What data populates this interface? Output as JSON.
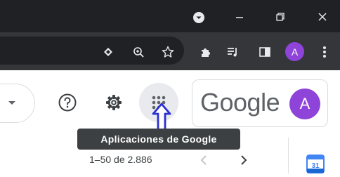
{
  "window": {
    "profile_icon": "chevron-down-circle-icon",
    "minimize_icon": "minimize-icon",
    "restore_icon": "restore-icon",
    "close_icon": "close-icon"
  },
  "toolbar": {
    "extension_icons": [
      "cast-icon",
      "zoom-icon",
      "star-icon",
      "puzzle-icon",
      "media-icon",
      "sidepanel-icon"
    ],
    "avatar_letter": "A",
    "menu_icon": "kebab-icon"
  },
  "header": {
    "help_icon": "help-icon",
    "settings_icon": "gear-icon",
    "apps_icon": "apps-grid-icon",
    "brand_word": "Google",
    "avatar_letter": "A",
    "tooltip": "Aplicaciones de Google"
  },
  "pager": {
    "range_text": "1–50 de 2.886"
  },
  "side": {
    "calendar_day": "31"
  },
  "colors": {
    "titlebar": "#202124",
    "toolbar": "#35363a",
    "avatar": "#8e44d8",
    "tooltip": "#3c4043",
    "arrow": "#2a2fd1"
  }
}
